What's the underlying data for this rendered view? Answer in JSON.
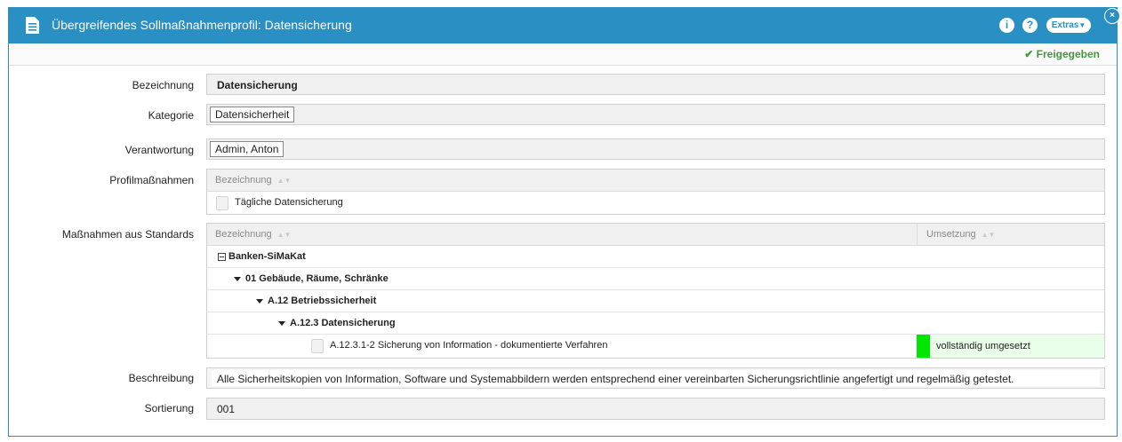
{
  "window": {
    "title": "Übergreifendes Sollmaßnahmenprofil: Datensicherung",
    "info_label": "i",
    "help_label": "?",
    "extras_label": "Extras",
    "close_label": "×",
    "status": "Freigegeben",
    "status_color": "#3f9a3f",
    "accent": "#2a8fc3"
  },
  "form": {
    "bezeichnung_label": "Bezeichnung",
    "bezeichnung_value": "Datensicherung",
    "kategorie_label": "Kategorie",
    "kategorie_value": "Datensicherheit",
    "verantwortung_label": "Verantwortung",
    "verantwortung_value": "Admin, Anton",
    "profil_label": "Profilmaßnahmen",
    "standards_label": "Maßnahmen aus Standards",
    "beschreibung_label": "Beschreibung",
    "beschreibung_value": "Alle Sicherheitskopien von Information, Software und Systemabbildern werden entsprechend einer vereinbarten Sicherungsrichtlinie angefertigt und regelmäßig getestet.",
    "sortierung_label": "Sortierung",
    "sortierung_value": "001"
  },
  "profil_table": {
    "col_bezeichnung": "Bezeichnung",
    "rows": [
      "Tägliche Datensicherung"
    ]
  },
  "standards_table": {
    "col_bezeichnung": "Bezeichnung",
    "col_umsetzung": "Umsetzung",
    "group": "Banken-SiMaKat",
    "level1": "01 Gebäude, Räume, Schränke",
    "level2": "A.12 Betriebssicherheit",
    "level3": "A.12.3 Datensicherung",
    "item": "A.12.3.1-2 Sicherung von Information - dokumentierte Verfahren",
    "item_status": "vollständig umgesetzt",
    "item_status_color": "#00e600"
  }
}
